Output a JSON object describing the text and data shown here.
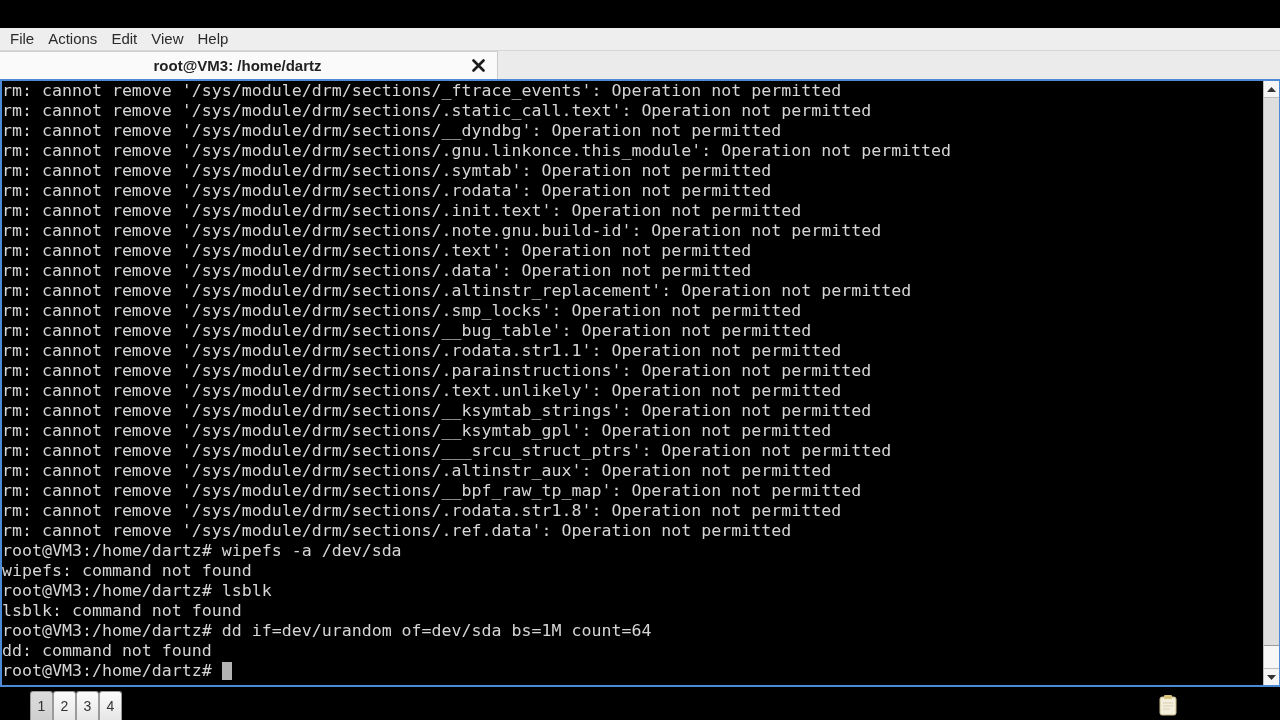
{
  "menu_bar": [
    "File",
    "Actions",
    "Edit",
    "View",
    "Help"
  ],
  "tabs": [
    {
      "title": "root@VM3: /home/dartz",
      "selected": true
    }
  ],
  "terminal": {
    "lines": [
      "rm: cannot remove '/sys/module/drm/sections/_ftrace_events': Operation not permitted",
      "rm: cannot remove '/sys/module/drm/sections/.static_call.text': Operation not permitted",
      "rm: cannot remove '/sys/module/drm/sections/__dyndbg': Operation not permitted",
      "rm: cannot remove '/sys/module/drm/sections/.gnu.linkonce.this_module': Operation not permitted",
      "rm: cannot remove '/sys/module/drm/sections/.symtab': Operation not permitted",
      "rm: cannot remove '/sys/module/drm/sections/.rodata': Operation not permitted",
      "rm: cannot remove '/sys/module/drm/sections/.init.text': Operation not permitted",
      "rm: cannot remove '/sys/module/drm/sections/.note.gnu.build-id': Operation not permitted",
      "rm: cannot remove '/sys/module/drm/sections/.text': Operation not permitted",
      "rm: cannot remove '/sys/module/drm/sections/.data': Operation not permitted",
      "rm: cannot remove '/sys/module/drm/sections/.altinstr_replacement': Operation not permitted",
      "rm: cannot remove '/sys/module/drm/sections/.smp_locks': Operation not permitted",
      "rm: cannot remove '/sys/module/drm/sections/__bug_table': Operation not permitted",
      "rm: cannot remove '/sys/module/drm/sections/.rodata.str1.1': Operation not permitted",
      "rm: cannot remove '/sys/module/drm/sections/.parainstructions': Operation not permitted",
      "rm: cannot remove '/sys/module/drm/sections/.text.unlikely': Operation not permitted",
      "rm: cannot remove '/sys/module/drm/sections/__ksymtab_strings': Operation not permitted",
      "rm: cannot remove '/sys/module/drm/sections/__ksymtab_gpl': Operation not permitted",
      "rm: cannot remove '/sys/module/drm/sections/___srcu_struct_ptrs': Operation not permitted",
      "rm: cannot remove '/sys/module/drm/sections/.altinstr_aux': Operation not permitted",
      "rm: cannot remove '/sys/module/drm/sections/__bpf_raw_tp_map': Operation not permitted",
      "rm: cannot remove '/sys/module/drm/sections/.rodata.str1.8': Operation not permitted",
      "rm: cannot remove '/sys/module/drm/sections/.ref.data': Operation not permitted",
      "root@VM3:/home/dartz# wipefs -a /dev/sda",
      "wipefs: command not found",
      "root@VM3:/home/dartz# lsblk",
      "lsblk: command not found",
      "root@VM3:/home/dartz# dd if=dev/urandom of=dev/sda bs=1M count=64",
      "dd: command not found",
      "root@VM3:/home/dartz#"
    ],
    "cursor": true
  },
  "panel": {
    "desktops": [
      {
        "label": "1",
        "selected": true
      },
      {
        "label": "2",
        "selected": false
      },
      {
        "label": "3",
        "selected": false
      },
      {
        "label": "4",
        "selected": false
      }
    ]
  }
}
